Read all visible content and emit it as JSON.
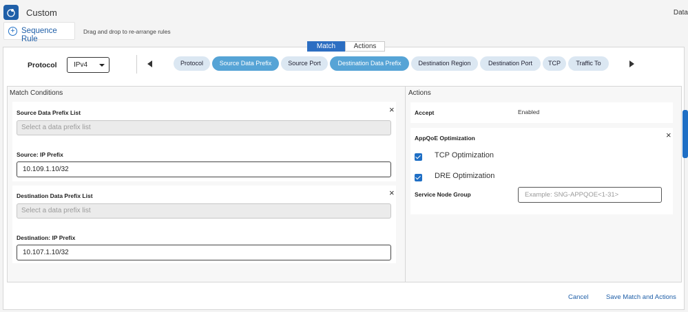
{
  "header": {
    "title": "Custom",
    "right_text": "Data",
    "icon": "policy-icon"
  },
  "sequence": {
    "button_label": "Sequence Rule",
    "hint": "Drag and drop to re-arrange rules"
  },
  "tabs": [
    {
      "label": "Match",
      "active": true
    },
    {
      "label": "Actions",
      "active": false
    }
  ],
  "protocol": {
    "label": "Protocol",
    "value": "IPv4"
  },
  "match_chips": [
    {
      "label": "Protocol",
      "selected": false
    },
    {
      "label": "Source Data Prefix",
      "selected": true
    },
    {
      "label": "Source Port",
      "selected": false
    },
    {
      "label": "Destination Data Prefix",
      "selected": true
    },
    {
      "label": "Destination Region",
      "selected": false
    },
    {
      "label": "Destination Port",
      "selected": false
    },
    {
      "label": "TCP",
      "selected": false
    },
    {
      "label": "Traffic To",
      "selected": false
    }
  ],
  "match_conditions": {
    "title": "Match Conditions",
    "source": {
      "list_label": "Source Data Prefix List",
      "list_placeholder": "Select a data prefix list",
      "ip_label": "Source: IP Prefix",
      "ip_value": "10.109.1.10/32"
    },
    "destination": {
      "list_label": "Destination Data Prefix List",
      "list_placeholder": "Select a data prefix list",
      "ip_label": "Destination: IP Prefix",
      "ip_value": "10.107.1.10/32"
    }
  },
  "actions": {
    "title": "Actions",
    "accept_label": "Accept",
    "accept_value": "Enabled",
    "appqoe_title": "AppQoE Optimization",
    "tcp_label": "TCP Optimization",
    "tcp_checked": true,
    "dre_label": "DRE Optimization",
    "dre_checked": true,
    "sng_label": "Service Node Group",
    "sng_placeholder": "Example: SNG-APPQOE<1-31>"
  },
  "footer": {
    "cancel": "Cancel",
    "save": "Save Match and Actions"
  },
  "colors": {
    "accent": "#1f6fc5",
    "chip_selected": "#56a4d6",
    "chip": "#dbe7f2"
  }
}
